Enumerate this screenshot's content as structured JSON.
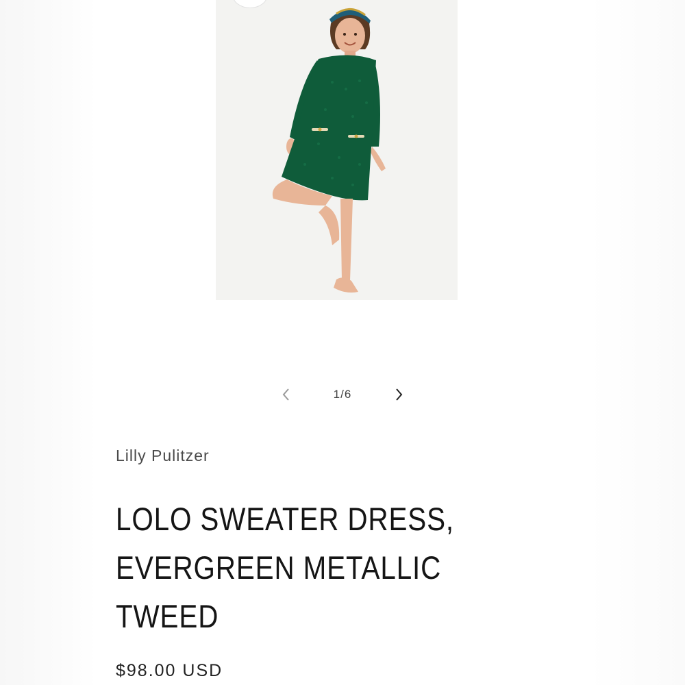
{
  "gallery": {
    "image_subject": "girl-in-green-sweater-dress",
    "counter": "1/6",
    "prev_icon": "chevron-left-icon",
    "next_icon": "chevron-right-icon",
    "zoom_icon": "zoom-icon"
  },
  "product": {
    "vendor": "Lilly Pulitzer",
    "title_lines": [
      "LOLO SWEATER DRESS,",
      "EVERGREEN METALLIC",
      "TWEED"
    ],
    "price": "$98.00 USD"
  },
  "colors": {
    "dress": "#0f5c3a",
    "image_bg": "#f3f3f1",
    "text": "#151515"
  }
}
